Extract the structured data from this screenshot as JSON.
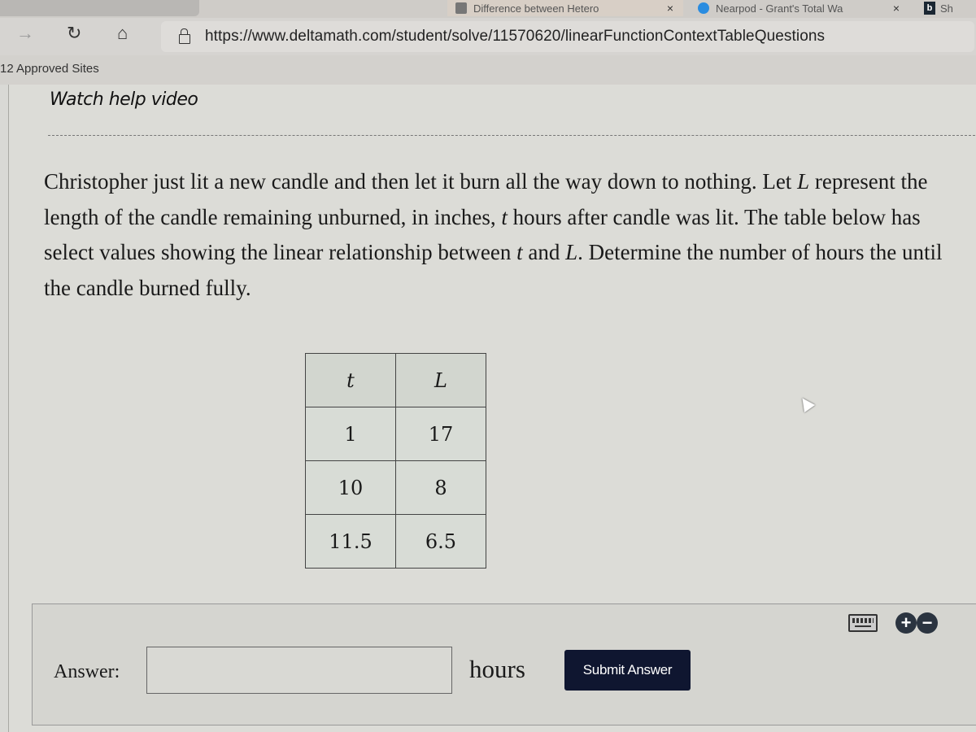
{
  "browser": {
    "tabs": [
      {
        "label": ""
      },
      {
        "label": "Difference between Hetero",
        "close": "×"
      },
      {
        "label": "Nearpod - Grant's Total Wa",
        "close": "×"
      },
      {
        "label": "Sh"
      }
    ],
    "url": "https://www.deltamath.com/student/solve/11570620/linearFunctionContextTableQuestions",
    "favorites_label": "12 Approved Sites",
    "nav_icons": {
      "forward": "→",
      "reload": "↻",
      "home": "⌂"
    }
  },
  "page": {
    "help_link": "Watch help video",
    "question": {
      "p1": "Christopher just lit a new candle and then let it burn all the way down to nothing. Let ",
      "var_L1": "L",
      "p2": " represent the length of the candle remaining unburned, in inches, ",
      "var_t1": "t",
      "p3": " hours after candle was lit. The table below has select values showing the linear relationship between ",
      "var_t2": "t",
      "p4": " and ",
      "var_L2": "L",
      "p5": ". Determine the number of hours the until the candle burned fully."
    },
    "table": {
      "headers": [
        "t",
        "L"
      ],
      "rows": [
        [
          "1",
          "17"
        ],
        [
          "10",
          "8"
        ],
        [
          "11.5",
          "6.5"
        ]
      ]
    },
    "answer": {
      "label": "Answer:",
      "value": "",
      "unit": "hours",
      "submit_label": "Submit Answer",
      "zoom_in": "+",
      "zoom_out": "−"
    }
  },
  "colors": {
    "submit_bg": "#0f1630",
    "zoom_btn_bg": "#2b3440"
  }
}
